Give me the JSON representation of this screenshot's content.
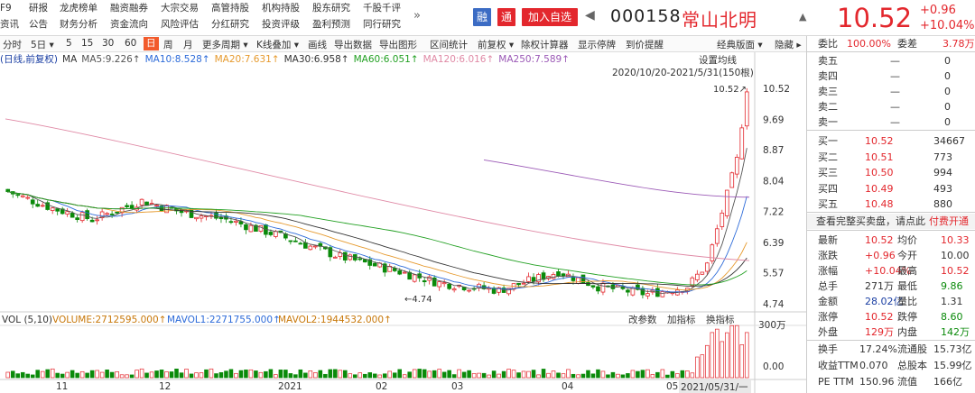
{
  "menu": {
    "col0": [
      "F9",
      "资讯"
    ],
    "items": [
      [
        "研报",
        "公告"
      ],
      [
        "龙虎榜单",
        "财务分析"
      ],
      [
        "融资融券",
        "资金流向"
      ],
      [
        "大宗交易",
        "风险评估"
      ],
      [
        "高管持股",
        "分红研究"
      ],
      [
        "机构持股",
        "投资评级"
      ],
      [
        "股东研究",
        "盈利预测"
      ],
      [
        "千股千评",
        "同行研究"
      ]
    ],
    "more": "»"
  },
  "header": {
    "rong": "融",
    "tong": "通",
    "add": "加入自选",
    "prev": "◀",
    "code": "000158",
    "name": "常山北明",
    "bell": "▲",
    "price": "10.52",
    "chg": "+0.96",
    "pct": "+10.04%"
  },
  "toolbar": {
    "items": [
      "分时",
      "5日 ▾",
      "5",
      "15",
      "30",
      "60",
      "日",
      "周",
      "月",
      "更多周期 ▾",
      "K线叠加 ▾",
      "画线",
      "导出数据",
      "导出图形",
      "区间统计",
      "前复权 ▾",
      "除权计算器",
      "显示停牌",
      "到价提醒"
    ],
    "right": [
      "经典版面 ▾",
      "隐藏 ▸"
    ]
  },
  "ma": {
    "prefix": "(日线,前复权)",
    "ma": "MA",
    "ma5": "MA5:9.226↑",
    "ma10": "MA10:8.528↑",
    "ma20": "MA20:7.631↑",
    "ma30": "MA30:6.958↑",
    "ma60": "MA60:6.051↑",
    "ma120": "MA120:6.016↑",
    "ma250": "MA250:7.589↑"
  },
  "chart_data": {
    "type": "candlestick",
    "range": "2020/10/20-2021/5/31(150根)",
    "setting": "设置均线",
    "yticks": [
      "10.52",
      "9.69",
      "8.87",
      "8.04",
      "7.22",
      "6.39",
      "5.57",
      "4.74"
    ],
    "xticks": [
      "11",
      "12",
      "2021",
      "02",
      "03",
      "04",
      "05"
    ],
    "xcursor": "2021/05/31/一",
    "hi_label": "10.52",
    "lo_label": "4.74",
    "vol_label": "VOL (5,10)",
    "vol": "VOLUME:2712595.000↑",
    "mavol1": "MAVOL1:2271755.000↑",
    "mavol2": "MAVOL2:1944532.000↑",
    "vol_btns": [
      "改参数",
      "加指标",
      "换指标"
    ],
    "vol_ticks": [
      "300万",
      "0.00"
    ],
    "colors": {
      "up": "#e3272d",
      "down": "#0a8a0a"
    }
  },
  "book": {
    "wb_label": "委比",
    "wb": "100.00%",
    "wc_label": "委差",
    "wc": "3.78万",
    "asks": [
      {
        "l": "卖五",
        "p": "—",
        "v": "0"
      },
      {
        "l": "卖四",
        "p": "—",
        "v": "0"
      },
      {
        "l": "卖三",
        "p": "—",
        "v": "0"
      },
      {
        "l": "卖二",
        "p": "—",
        "v": "0"
      },
      {
        "l": "卖一",
        "p": "—",
        "v": "0"
      }
    ],
    "bids": [
      {
        "l": "买一",
        "p": "10.52",
        "v": "34667"
      },
      {
        "l": "买二",
        "p": "10.51",
        "v": "773"
      },
      {
        "l": "买三",
        "p": "10.50",
        "v": "994"
      },
      {
        "l": "买四",
        "p": "10.49",
        "v": "493"
      },
      {
        "l": "买五",
        "p": "10.48",
        "v": "880"
      }
    ],
    "full": "查看完整买卖盘，请点此",
    "paid": "付费开通"
  },
  "stats": [
    [
      "最新",
      "10.52",
      "均价",
      "10.33"
    ],
    [
      "涨跌",
      "+0.96",
      "今开",
      "10.00"
    ],
    [
      "涨幅",
      "+10.04%",
      "最高",
      "10.52"
    ],
    [
      "总手",
      "271万",
      "最低",
      "9.86"
    ],
    [
      "金额",
      "28.02亿",
      "量比",
      "1.31"
    ],
    [
      "涨停",
      "10.52",
      "跌停",
      "8.60"
    ],
    [
      "外盘",
      "129万",
      "内盘",
      "142万"
    ]
  ],
  "stats2": [
    [
      "换手",
      "17.24%",
      "流通股",
      "15.73亿"
    ],
    [
      "收益TTM",
      "0.070",
      "总股本",
      "15.99亿"
    ],
    [
      "PE TTM",
      "150.96",
      "流值",
      "166亿"
    ]
  ]
}
